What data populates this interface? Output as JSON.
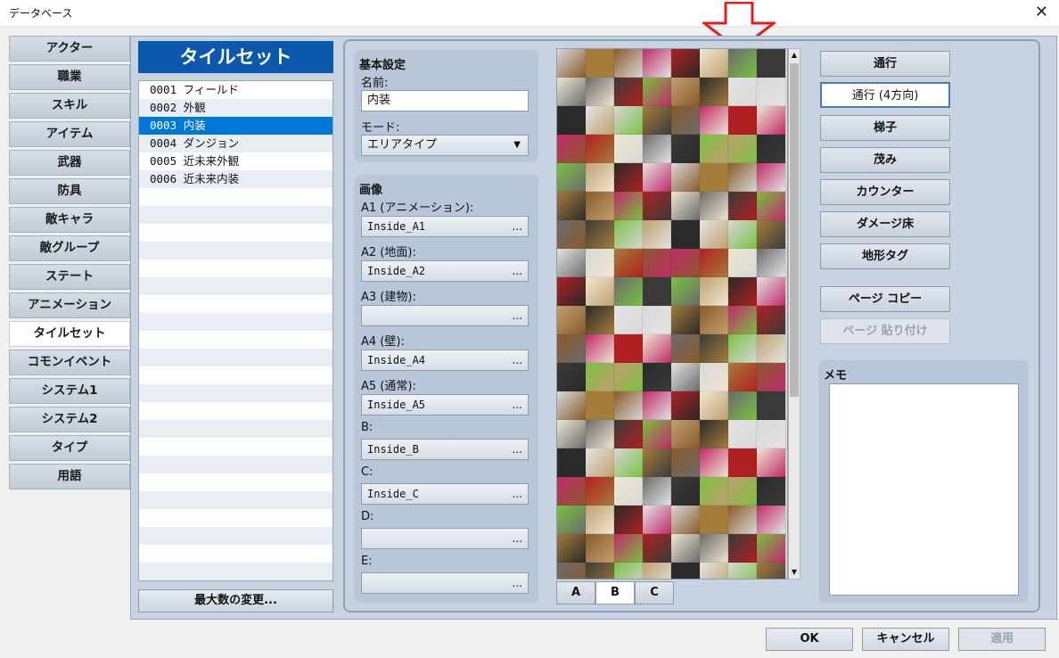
{
  "window": {
    "title": "データベース",
    "close_glyph": "✕"
  },
  "categories": [
    {
      "label": "アクター"
    },
    {
      "label": "職業"
    },
    {
      "label": "スキル"
    },
    {
      "label": "アイテム"
    },
    {
      "label": "武器"
    },
    {
      "label": "防具"
    },
    {
      "label": "敵キャラ"
    },
    {
      "label": "敵グループ"
    },
    {
      "label": "ステート"
    },
    {
      "label": "アニメーション"
    },
    {
      "label": "タイルセット",
      "active": true
    },
    {
      "label": "コモンイベント"
    },
    {
      "label": "システム1"
    },
    {
      "label": "システム2"
    },
    {
      "label": "タイプ"
    },
    {
      "label": "用語"
    }
  ],
  "tileset": {
    "header": "タイルセット",
    "items": [
      {
        "text": "0001 フィールド"
      },
      {
        "text": "0002 外観"
      },
      {
        "text": "0003 内装",
        "selected": true
      },
      {
        "text": "0004 ダンジョン"
      },
      {
        "text": "0005 近未来外観"
      },
      {
        "text": "0006 近未来内装"
      }
    ],
    "max_button": "最大数の変更..."
  },
  "basic": {
    "title": "基本設定",
    "name_label": "名前:",
    "name_value": "内装",
    "mode_label": "モード:",
    "mode_value": "エリアタイプ",
    "mode_arrow": "▼"
  },
  "images": {
    "title": "画像",
    "dots": "...",
    "slots": [
      {
        "label": "A1 (アニメーション):",
        "value": "Inside_A1"
      },
      {
        "label": "A2 (地面):",
        "value": "Inside_A2"
      },
      {
        "label": "A3 (建物):",
        "value": ""
      },
      {
        "label": "A4 (壁):",
        "value": "Inside_A4"
      },
      {
        "label": "A5 (通常):",
        "value": "Inside_A5"
      },
      {
        "label": "B:",
        "value": "Inside_B"
      },
      {
        "label": "C:",
        "value": "Inside_C"
      },
      {
        "label": "D:",
        "value": ""
      },
      {
        "label": "E:",
        "value": ""
      }
    ]
  },
  "tile_tabs": [
    {
      "label": "A"
    },
    {
      "label": "B",
      "active": true
    },
    {
      "label": "C"
    }
  ],
  "scroll": {
    "up": "▲",
    "down": "▼"
  },
  "flags": [
    {
      "label": "通行"
    },
    {
      "label": "通行 (4方向)",
      "active": true
    },
    {
      "label": "梯子"
    },
    {
      "label": "茂み"
    },
    {
      "label": "カウンター"
    },
    {
      "label": "ダメージ床"
    },
    {
      "label": "地形タグ"
    }
  ],
  "page_copy": "ページ コピー",
  "page_paste": "ページ 貼り付け",
  "memo": {
    "title": "メモ",
    "value": ""
  },
  "dialog": {
    "ok": "OK",
    "cancel": "キャンセル",
    "apply": "適用"
  },
  "colors": {
    "accent": "#0b58ac",
    "selection": "#0078d7",
    "arrow": "#e02020"
  }
}
